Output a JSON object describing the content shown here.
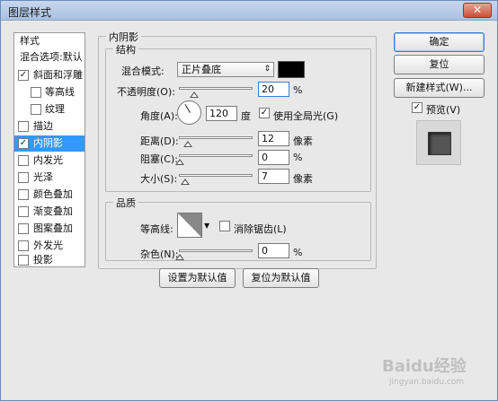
{
  "window": {
    "title": "图层样式",
    "close_label": "✕"
  },
  "styles_panel": {
    "header": "样式",
    "blend_default": "混合选项:默认",
    "items": [
      {
        "label": "斜面和浮雕",
        "checked": true
      },
      {
        "label": "等高线",
        "checked": false
      },
      {
        "label": "纹理",
        "checked": false
      },
      {
        "label": "描边",
        "checked": false
      },
      {
        "label": "内阴影",
        "checked": true
      },
      {
        "label": "内发光",
        "checked": false
      },
      {
        "label": "光泽",
        "checked": false
      },
      {
        "label": "颜色叠加",
        "checked": false
      },
      {
        "label": "渐变叠加",
        "checked": false
      },
      {
        "label": "图案叠加",
        "checked": false
      },
      {
        "label": "外发光",
        "checked": false
      },
      {
        "label": "投影",
        "checked": false
      }
    ]
  },
  "panel": {
    "title": "内阴影",
    "structure": {
      "legend": "结构",
      "blend_mode_label": "混合模式:",
      "blend_mode_value": "正片叠底",
      "shadow_color": "#000000",
      "opacity_label": "不透明度(O):",
      "opacity_value": "20",
      "opacity_unit": "%",
      "angle_label": "角度(A):",
      "angle_value": "120",
      "angle_unit": "度",
      "global_light_label": "使用全局光(G)",
      "global_light_checked": true,
      "distance_label": "距离(D):",
      "distance_value": "12",
      "distance_unit": "像素",
      "choke_label": "阻塞(C):",
      "choke_value": "0",
      "choke_unit": "%",
      "size_label": "大小(S):",
      "size_value": "7",
      "size_unit": "像素"
    },
    "quality": {
      "legend": "品质",
      "contour_label": "等高线:",
      "anti_alias_label": "消除锯齿(L)",
      "anti_alias_checked": false,
      "noise_label": "杂色(N):",
      "noise_value": "0",
      "noise_unit": "%"
    },
    "set_default": "设置为默认值",
    "reset_default": "复位为默认值"
  },
  "buttons": {
    "ok": "确定",
    "reset": "复位",
    "new_style": "新建样式(W)...",
    "preview_label": "预览(V)",
    "preview_checked": true
  },
  "watermark": {
    "text": "Baidu经验",
    "sub": "jingyan.baidu.com"
  }
}
